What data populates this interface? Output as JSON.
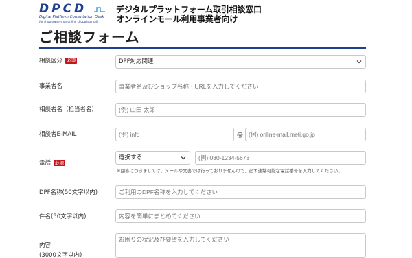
{
  "header": {
    "logo_text": "DPCD",
    "logo_sub1": "Digital Platform Consultation Desk",
    "logo_sub2": "for shop owners on online shopping mall",
    "title_line1": "デジタルプラットフォーム取引相談窓口",
    "title_line2": "オンラインモール利用事業者向け",
    "brand_color": "#1f3f8f"
  },
  "form": {
    "title": "ご相談フォーム",
    "required_badge": "必須",
    "required_color": "#c4161c",
    "category": {
      "label": "相談区分",
      "value": "DPF対応関連"
    },
    "business_name": {
      "label": "事業者名",
      "placeholder": "事業者名及びショップ名称・URLを入力してください"
    },
    "consultant_name": {
      "label": "相談者名（担当者名）",
      "placeholder": "(例) 山田 太郎"
    },
    "email": {
      "label": "相談者E-MAIL",
      "local_placeholder": "(例) info",
      "at": "@",
      "domain_placeholder": "(例) online-mall.meti.go.jp"
    },
    "phone": {
      "label": "電話",
      "select_value": "選択する",
      "placeholder": "(例) 080-1234-5678",
      "note": "※回答につきましては、メールや文書では行っておりませんので、必ず連絡可能な電話番号を入力してください。"
    },
    "dpf_name": {
      "label": "DPF名称(50文字以内)",
      "placeholder": "ご利用のDPF名称を入力してください"
    },
    "subject": {
      "label": "件名(50文字以内)",
      "placeholder": "内容を簡単にまとめてください"
    },
    "content": {
      "label": "内容",
      "label_sub": "(3000文字以内)",
      "placeholder": "お困りの状況及び要望を入力してください"
    }
  }
}
